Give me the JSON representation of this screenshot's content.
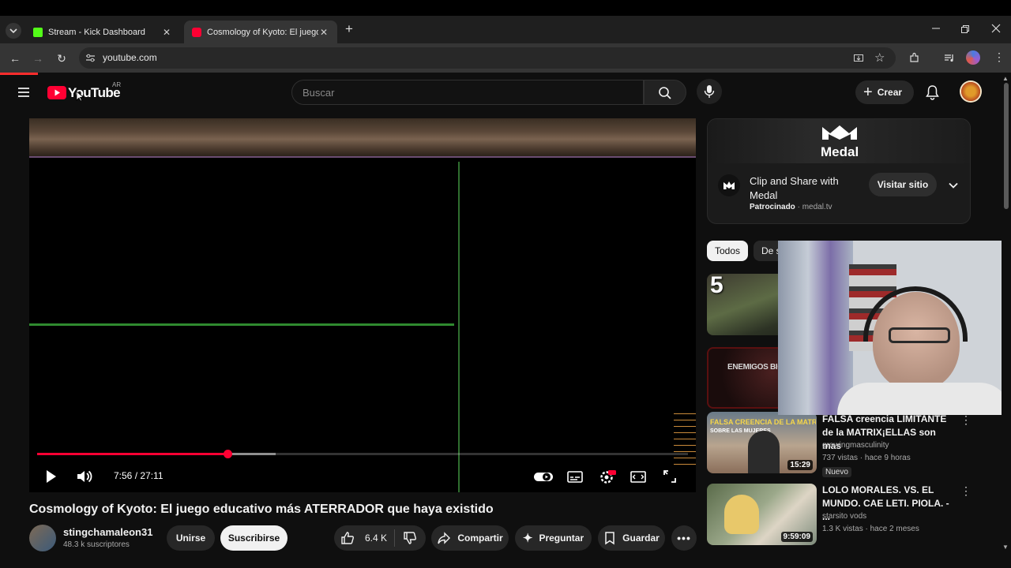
{
  "browser": {
    "tabs": [
      {
        "label": "Stream - Kick Dashboard",
        "favicon_color": "#53fc18"
      },
      {
        "label": "Cosmology of Kyoto: El juego e",
        "favicon_color": "#ff0033"
      }
    ],
    "url": "youtube.com"
  },
  "header": {
    "logo_text": "YouTube",
    "region": "AR",
    "search_placeholder": "Buscar",
    "create_label": "Crear"
  },
  "player": {
    "time": "7:56 / 27:11",
    "progress_fraction": 0.292,
    "buffered_fraction": 0.367
  },
  "video": {
    "title": "Cosmology of Kyoto: El juego educativo más ATERRADOR que haya existido",
    "channel": "stingchamaleon31",
    "subscribers": "48.3 k suscriptores",
    "join_label": "Unirse",
    "subscribe_label": "Suscribirse",
    "likes": "6.4 K",
    "share_label": "Compartir",
    "ask_label": "Preguntar",
    "save_label": "Guardar"
  },
  "ad": {
    "brand": "Medal",
    "title": "Clip and Share with Medal",
    "sponsored": "Patrocinado",
    "domain": "medal.tv",
    "visit_label": "Visitar sitio"
  },
  "chips": [
    "Todos",
    "De s"
  ],
  "recommendations": [
    {
      "thumb_text": "5",
      "duration": ""
    },
    {
      "thumb_text": "ENEMIGOS BIOLÓ",
      "duration": ""
    },
    {
      "thumb_text": "FALSA CREENCIA DE LA MATRIX",
      "thumb_sub": "SOBRE LAS MUJERES",
      "title": "FALSA creencia LIMITANTE de la MATRIX¡ELLAS son mas",
      "channel": "growingmasculinity",
      "meta": "737 vistas · hace 9 horas",
      "badge": "Nuevo",
      "duration": "15:29"
    },
    {
      "title": "LOLO MORALES. VS. EL MUNDO. CAE LETI. PIOLA. - ...",
      "channel": "starsito vods",
      "meta": "1.3 K vistas · hace 2 meses",
      "duration": "9:59:09"
    }
  ],
  "colors": {
    "accent": "#ff0033",
    "background": "#0f0f0f",
    "chip_active": "#f1f1f1"
  }
}
